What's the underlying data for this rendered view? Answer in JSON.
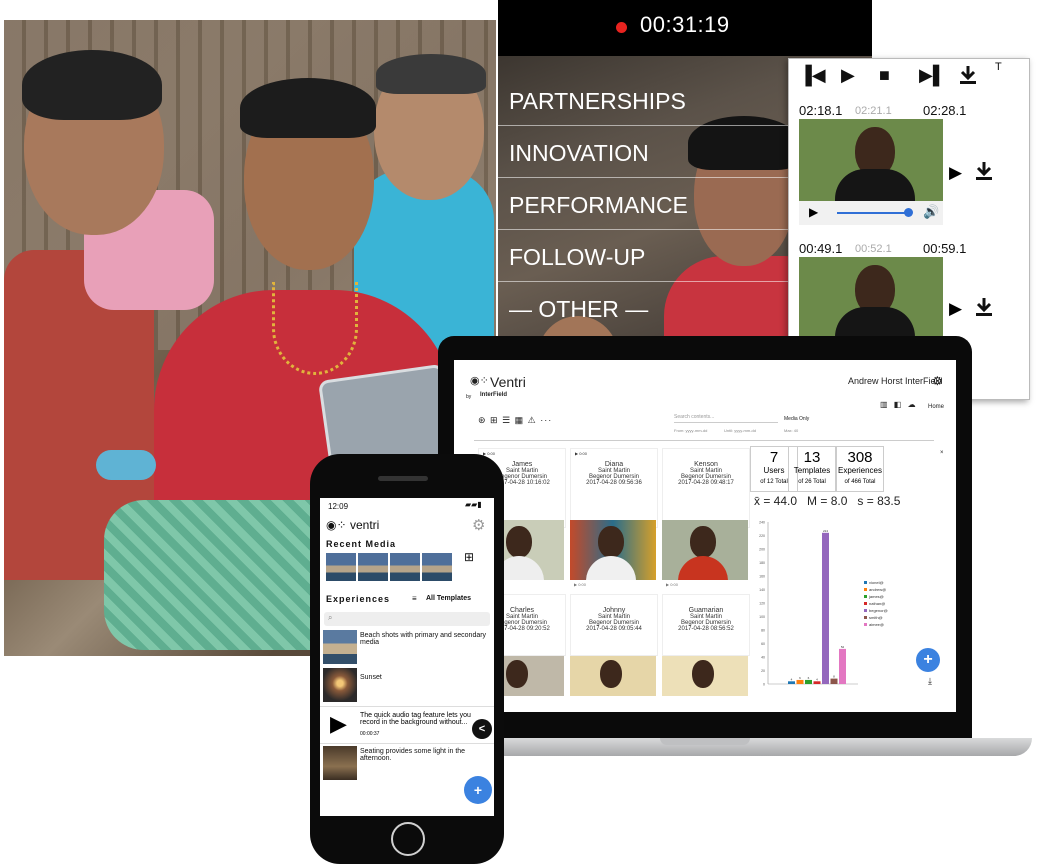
{
  "video": {
    "recording_time": "00:31:19",
    "categories": [
      "PARTNERSHIPS",
      "INNOVATION",
      "PERFORMANCE",
      "FOLLOW-UP",
      "— OTHER —"
    ]
  },
  "player": {
    "t_label": "T",
    "clips": [
      {
        "start": "02:18.1",
        "mid": "02:21.1",
        "end": "02:28.1"
      },
      {
        "start": "00:49.1",
        "mid": "00:52.1",
        "end": "00:59.1"
      }
    ],
    "volume_level": 0.75
  },
  "laptop": {
    "app_title": "Ventri",
    "brand": "InterField",
    "brand_prefix": "by",
    "user": "Andrew Horst InterField",
    "home": "Home",
    "search_placeholder": "Search contents...",
    "media_only": "Media Only",
    "from_label": "From: yyyy-mm-dd",
    "until_label": "Until: yyyy-mm-dd",
    "max_label": "Max: 40",
    "stats": [
      {
        "value": "7",
        "label": "Users",
        "sub": "of 12 Total"
      },
      {
        "value": "13",
        "label": "Templates",
        "sub": "of 26 Total"
      },
      {
        "value": "308",
        "label": "Experiences",
        "sub": "of 466 Total"
      }
    ],
    "summary": "x̄ = 44.0   M = 8.0   s = 83.5",
    "cards_row1": [
      {
        "name": "James",
        "place": "Saint Martin",
        "person": "Begenor Dumersin",
        "date": "2017-04-28 10:16:02"
      },
      {
        "name": "Diana",
        "place": "Saint Martin",
        "person": "Begenor Dumersin",
        "date": "2017-04-28 09:56:36"
      },
      {
        "name": "Kenson",
        "place": "Saint Martin",
        "person": "Begenor Dumersin",
        "date": "2017-04-28 09:48:17"
      }
    ],
    "cards_row2": [
      {
        "name": "Charles",
        "place": "Saint Martin",
        "person": "Begenor Dumersin",
        "date": "2017-04-28 09:20:52"
      },
      {
        "name": "Johnny",
        "place": "Saint Martin",
        "person": "Begenor Dumersin",
        "date": "2017-04-28 09:05:44"
      },
      {
        "name": "Guamarian",
        "place": "Saint Martin",
        "person": "Begenor Dumersin",
        "date": "2017-04-28 08:56:52"
      }
    ],
    "time_chip": "0:00",
    "fab": "+"
  },
  "chart_data": {
    "type": "bar",
    "categories": [
      "vionel@",
      "andrew@",
      "james@",
      "nathan@",
      "begenor@",
      "smith@",
      "aimee@"
    ],
    "values": [
      4,
      6,
      6,
      4,
      224,
      8,
      52
    ],
    "colors": [
      "#1f77b4",
      "#ff7f0e",
      "#2ca02c",
      "#d62728",
      "#9467bd",
      "#8c564b",
      "#e377c2"
    ],
    "ylim": [
      0,
      240
    ],
    "yticks": [
      0,
      20,
      40,
      60,
      80,
      100,
      120,
      140,
      160,
      180,
      200,
      220,
      240
    ]
  },
  "phone": {
    "time": "12:09",
    "app_name": "ventri",
    "recent_media": "Recent Media",
    "experiences": "Experiences",
    "all_templates": "All Templates",
    "experience_items": [
      {
        "text": "Beach shots with primary and secondary media",
        "time": ""
      },
      {
        "text": "Sunset",
        "time": ""
      },
      {
        "text": "The quick audio tag feature lets you record in the background without...",
        "time": "00:00:37"
      },
      {
        "text": "Seating provides some light in the afternoon.",
        "time": ""
      }
    ],
    "fab": "+",
    "back": "<"
  }
}
